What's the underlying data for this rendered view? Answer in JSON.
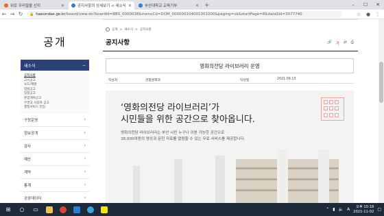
{
  "browser": {
    "tabs": [
      {
        "title": "위로 우리말을 선지",
        "color": "#e66a2c",
        "active": false
      },
      {
        "title": "공지사항의 상세보기 < 새소식",
        "color": "#2d7fd3",
        "active": true
      },
      {
        "title": "부산대학교 교육기부",
        "color": "#2d7fd3",
        "active": false
      }
    ],
    "new_tab": "+",
    "url_host": "haeundae.go.kr",
    "url_path": "/board/view.do?boardId=BBS_0000038&menuCd=DOM_000000104001001000&paging=ok&startPage=8&dataSid=3077740"
  },
  "sidebar": {
    "title": "공개",
    "section_label": "새소식",
    "sub_items": [
      "공지사항",
      "고시공고",
      "보도/해명",
      "입법공고",
      "입찰공고",
      "분양계획공고",
      "무연고 사망자 공고",
      "행정서비스 헌장"
    ],
    "items": [
      "구정운영",
      "정보공개",
      "감사",
      "예산",
      "계약",
      "통계",
      "공공데이터"
    ]
  },
  "main": {
    "breadcrumb": [
      "공개",
      "새소식",
      "공지사항"
    ],
    "page_title": "공지사항",
    "tool_labels": [
      "가"
    ],
    "post": {
      "title": "영화의전당 라이브러리 운영",
      "author_label": "작성자",
      "author": "관광문화과",
      "date_label": "작성일",
      "date": "2021.09.13"
    },
    "poster": {
      "headline_line1": "‘영화의전당 라이브러리’가",
      "headline_line2": "시민들을 위한 공간으로 찾아옵니다.",
      "desc_line1": "영화의전당 라이브러리는 부산 시민 누구나 이용 가능한 공간으로",
      "desc_line2": "38,000여종의 영상과 문헌 자료를 열람할 수 있는 무료 서비스를 제공합니다."
    }
  },
  "taskbar": {
    "lang": "A",
    "ampm": "오후",
    "time": "10:18",
    "date": "2021-11-02"
  }
}
